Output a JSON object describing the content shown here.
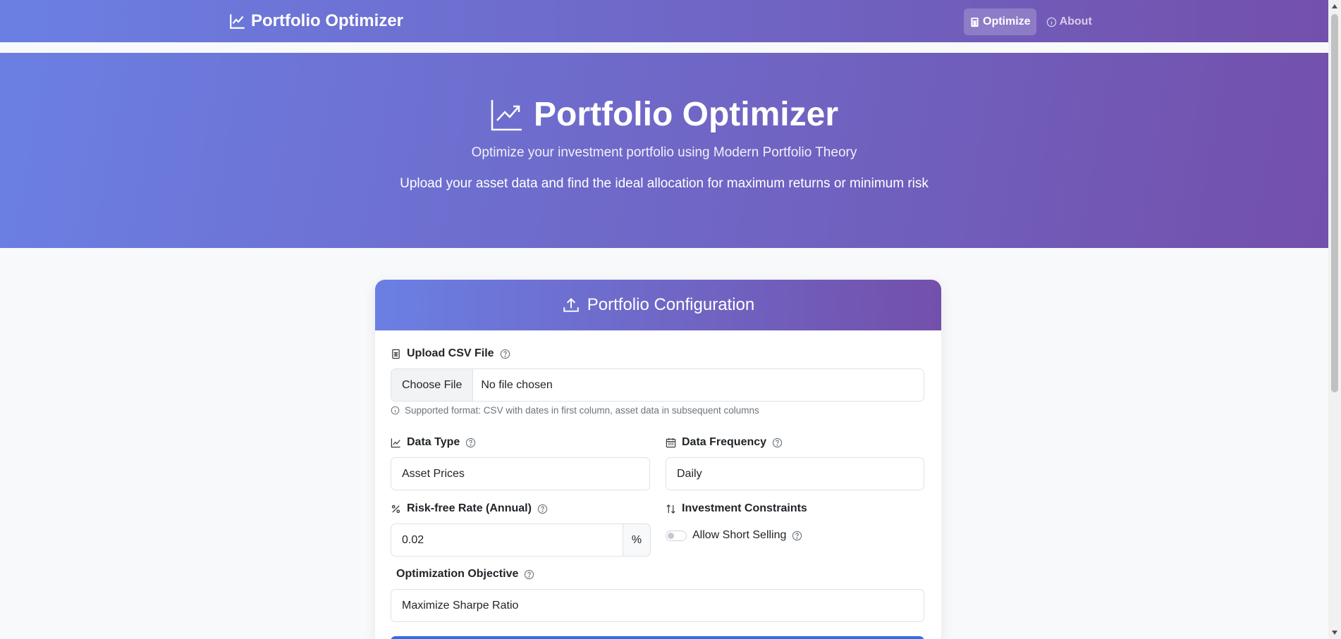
{
  "navbar": {
    "brand": "Portfolio Optimizer",
    "links": [
      {
        "label": "Optimize",
        "icon": "calculator-icon",
        "active": true
      },
      {
        "label": "About",
        "icon": "info-circle-icon",
        "active": false
      }
    ]
  },
  "hero": {
    "title": "Portfolio Optimizer",
    "subtitle": "Optimize your investment portfolio using Modern Portfolio Theory",
    "description": "Upload your asset data and find the ideal allocation for maximum returns or minimum risk"
  },
  "config": {
    "title": "Portfolio Configuration",
    "upload": {
      "label": "Upload CSV File",
      "button": "Choose File",
      "status": "No file chosen",
      "hint": "Supported format: CSV with dates in first column, asset data in subsequent columns"
    },
    "data_type": {
      "label": "Data Type",
      "value": "Asset Prices"
    },
    "data_frequency": {
      "label": "Data Frequency",
      "value": "Daily"
    },
    "risk_free": {
      "label": "Risk-free Rate (Annual)",
      "value": "0.02",
      "unit": "%"
    },
    "constraints": {
      "label": "Investment Constraints",
      "short_selling": "Allow Short Selling",
      "short_selling_on": false
    },
    "objective": {
      "label": "Optimization Objective",
      "value": "Maximize Sharpe Ratio"
    }
  },
  "colors": {
    "gradient_start": "#6b7fe3",
    "gradient_end": "#7350ab",
    "primary": "#2f6fe4"
  }
}
